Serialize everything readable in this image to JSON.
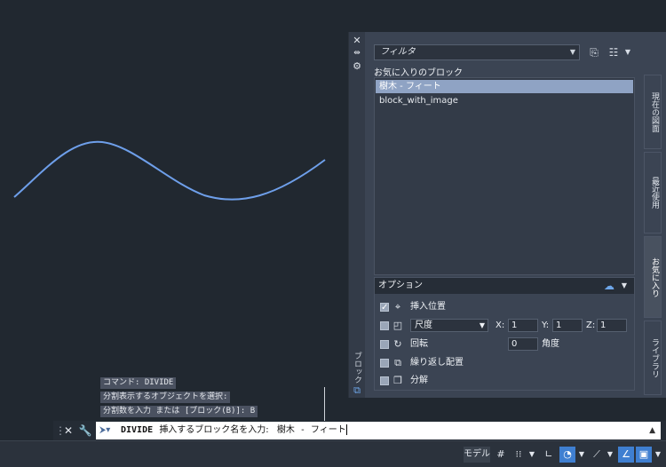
{
  "palette": {
    "bar_title": "ブロック",
    "filter_placeholder": "フィルタ",
    "favorites_label": "お気に入りのブロック",
    "items": [
      {
        "label": "樹木 - フィート",
        "selected": true
      },
      {
        "label": "block_with_image",
        "selected": false
      }
    ],
    "options": {
      "header": "オプション",
      "insertion_point": {
        "label": "挿入位置",
        "checked": true
      },
      "scale": {
        "value": "尺度",
        "x_label": "X:",
        "x": "1",
        "y_label": "Y:",
        "y": "1",
        "z_label": "Z:",
        "z": "1",
        "checked": false
      },
      "rotation": {
        "label": "回転",
        "angle_value": "0",
        "angle_label": "角度",
        "checked": false
      },
      "repeat": {
        "label": "繰り返し配置",
        "checked": false
      },
      "explode": {
        "label": "分解",
        "checked": false
      }
    },
    "tabs": [
      "現在の図面",
      "最近使用",
      "お気に入り",
      "ライブラリ"
    ],
    "active_tab": "お気に入り"
  },
  "history": [
    "コマンド: DIVIDE",
    "分割表示するオブジェクトを選択:",
    "分割数を入力 または [ブロック(B)]: B"
  ],
  "command": {
    "name": "DIVIDE",
    "prompt": "挿入するブロック名を入力:",
    "typed": "樹木 - フィート"
  },
  "status": {
    "model_label": "モデル"
  },
  "colors": {
    "curve": "#6e9fea",
    "accent": "#3f7fd1"
  }
}
